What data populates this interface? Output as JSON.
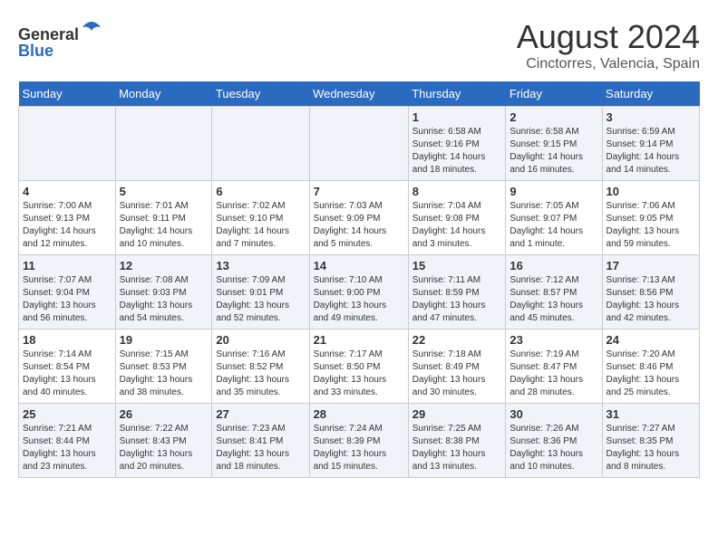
{
  "header": {
    "logo_line1": "General",
    "logo_line2": "Blue",
    "month_title": "August 2024",
    "location": "Cinctorres, Valencia, Spain"
  },
  "weekdays": [
    "Sunday",
    "Monday",
    "Tuesday",
    "Wednesday",
    "Thursday",
    "Friday",
    "Saturday"
  ],
  "weeks": [
    [
      {
        "day": "",
        "info": ""
      },
      {
        "day": "",
        "info": ""
      },
      {
        "day": "",
        "info": ""
      },
      {
        "day": "",
        "info": ""
      },
      {
        "day": "1",
        "info": "Sunrise: 6:58 AM\nSunset: 9:16 PM\nDaylight: 14 hours\nand 18 minutes."
      },
      {
        "day": "2",
        "info": "Sunrise: 6:58 AM\nSunset: 9:15 PM\nDaylight: 14 hours\nand 16 minutes."
      },
      {
        "day": "3",
        "info": "Sunrise: 6:59 AM\nSunset: 9:14 PM\nDaylight: 14 hours\nand 14 minutes."
      }
    ],
    [
      {
        "day": "4",
        "info": "Sunrise: 7:00 AM\nSunset: 9:13 PM\nDaylight: 14 hours\nand 12 minutes."
      },
      {
        "day": "5",
        "info": "Sunrise: 7:01 AM\nSunset: 9:11 PM\nDaylight: 14 hours\nand 10 minutes."
      },
      {
        "day": "6",
        "info": "Sunrise: 7:02 AM\nSunset: 9:10 PM\nDaylight: 14 hours\nand 7 minutes."
      },
      {
        "day": "7",
        "info": "Sunrise: 7:03 AM\nSunset: 9:09 PM\nDaylight: 14 hours\nand 5 minutes."
      },
      {
        "day": "8",
        "info": "Sunrise: 7:04 AM\nSunset: 9:08 PM\nDaylight: 14 hours\nand 3 minutes."
      },
      {
        "day": "9",
        "info": "Sunrise: 7:05 AM\nSunset: 9:07 PM\nDaylight: 14 hours\nand 1 minute."
      },
      {
        "day": "10",
        "info": "Sunrise: 7:06 AM\nSunset: 9:05 PM\nDaylight: 13 hours\nand 59 minutes."
      }
    ],
    [
      {
        "day": "11",
        "info": "Sunrise: 7:07 AM\nSunset: 9:04 PM\nDaylight: 13 hours\nand 56 minutes."
      },
      {
        "day": "12",
        "info": "Sunrise: 7:08 AM\nSunset: 9:03 PM\nDaylight: 13 hours\nand 54 minutes."
      },
      {
        "day": "13",
        "info": "Sunrise: 7:09 AM\nSunset: 9:01 PM\nDaylight: 13 hours\nand 52 minutes."
      },
      {
        "day": "14",
        "info": "Sunrise: 7:10 AM\nSunset: 9:00 PM\nDaylight: 13 hours\nand 49 minutes."
      },
      {
        "day": "15",
        "info": "Sunrise: 7:11 AM\nSunset: 8:59 PM\nDaylight: 13 hours\nand 47 minutes."
      },
      {
        "day": "16",
        "info": "Sunrise: 7:12 AM\nSunset: 8:57 PM\nDaylight: 13 hours\nand 45 minutes."
      },
      {
        "day": "17",
        "info": "Sunrise: 7:13 AM\nSunset: 8:56 PM\nDaylight: 13 hours\nand 42 minutes."
      }
    ],
    [
      {
        "day": "18",
        "info": "Sunrise: 7:14 AM\nSunset: 8:54 PM\nDaylight: 13 hours\nand 40 minutes."
      },
      {
        "day": "19",
        "info": "Sunrise: 7:15 AM\nSunset: 8:53 PM\nDaylight: 13 hours\nand 38 minutes."
      },
      {
        "day": "20",
        "info": "Sunrise: 7:16 AM\nSunset: 8:52 PM\nDaylight: 13 hours\nand 35 minutes."
      },
      {
        "day": "21",
        "info": "Sunrise: 7:17 AM\nSunset: 8:50 PM\nDaylight: 13 hours\nand 33 minutes."
      },
      {
        "day": "22",
        "info": "Sunrise: 7:18 AM\nSunset: 8:49 PM\nDaylight: 13 hours\nand 30 minutes."
      },
      {
        "day": "23",
        "info": "Sunrise: 7:19 AM\nSunset: 8:47 PM\nDaylight: 13 hours\nand 28 minutes."
      },
      {
        "day": "24",
        "info": "Sunrise: 7:20 AM\nSunset: 8:46 PM\nDaylight: 13 hours\nand 25 minutes."
      }
    ],
    [
      {
        "day": "25",
        "info": "Sunrise: 7:21 AM\nSunset: 8:44 PM\nDaylight: 13 hours\nand 23 minutes."
      },
      {
        "day": "26",
        "info": "Sunrise: 7:22 AM\nSunset: 8:43 PM\nDaylight: 13 hours\nand 20 minutes."
      },
      {
        "day": "27",
        "info": "Sunrise: 7:23 AM\nSunset: 8:41 PM\nDaylight: 13 hours\nand 18 minutes."
      },
      {
        "day": "28",
        "info": "Sunrise: 7:24 AM\nSunset: 8:39 PM\nDaylight: 13 hours\nand 15 minutes."
      },
      {
        "day": "29",
        "info": "Sunrise: 7:25 AM\nSunset: 8:38 PM\nDaylight: 13 hours\nand 13 minutes."
      },
      {
        "day": "30",
        "info": "Sunrise: 7:26 AM\nSunset: 8:36 PM\nDaylight: 13 hours\nand 10 minutes."
      },
      {
        "day": "31",
        "info": "Sunrise: 7:27 AM\nSunset: 8:35 PM\nDaylight: 13 hours\nand 8 minutes."
      }
    ]
  ]
}
